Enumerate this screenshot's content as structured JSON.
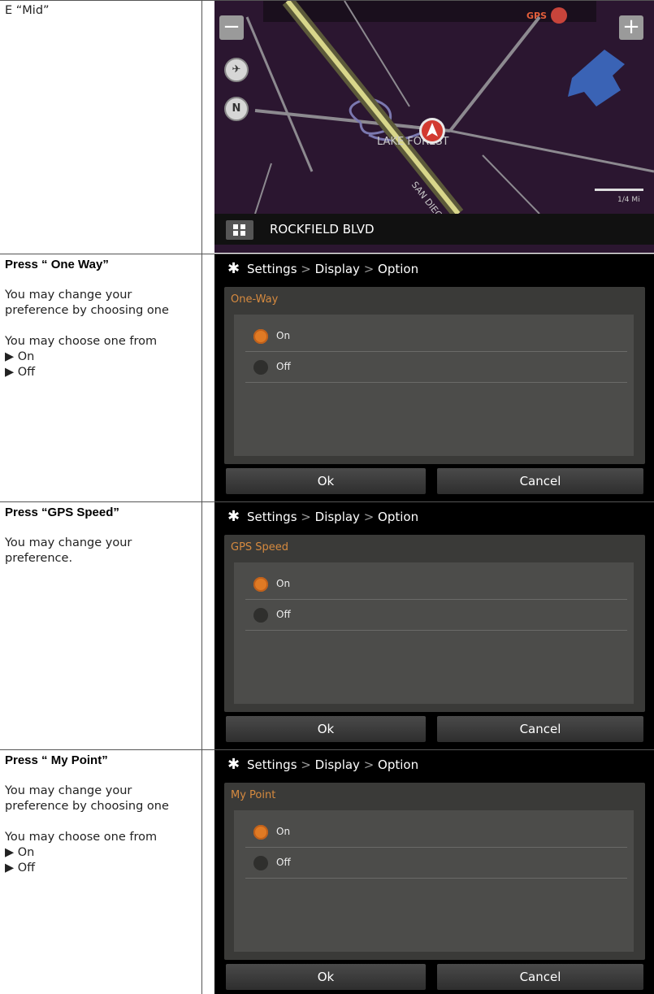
{
  "map_row": {
    "caption": "E “Mid”",
    "map": {
      "zoom_out": "−",
      "zoom_in": "+",
      "gps_label": "GPS",
      "compass_label": "N",
      "area_label": "LAKE FOREST",
      "road_label": "SAN DIEGO",
      "scale_label": "1/4 Mi",
      "street_name": "ROCKFIELD BLVD"
    }
  },
  "sections": [
    {
      "title": "Press “ One Way”",
      "desc1": "You may change your preference by choosing one",
      "desc2": "You may choose one from",
      "bullet1": "▶ On",
      "bullet2": "▶ Off",
      "screen": {
        "breadcrumb": [
          "Settings",
          "Display",
          "Option"
        ],
        "panel_title": "One-Way",
        "option_on": "On",
        "option_off": "Off",
        "selected": "On",
        "ok": "Ok",
        "cancel": "Cancel"
      }
    },
    {
      "title": "Press “GPS Speed”",
      "desc1": "You may change your preference.",
      "screen": {
        "breadcrumb": [
          "Settings",
          "Display",
          "Option"
        ],
        "panel_title": "GPS Speed",
        "option_on": "On",
        "option_off": "Off",
        "selected": "On",
        "ok": "Ok",
        "cancel": "Cancel"
      }
    },
    {
      "title": "Press “ My Point”",
      "desc1": "You may change your preference by choosing one",
      "desc2": "You may choose one from",
      "bullet1": "▶ On",
      "bullet2": "▶ Off",
      "screen": {
        "breadcrumb": [
          "Settings",
          "Display",
          "Option"
        ],
        "panel_title": "My Point",
        "option_on": "On",
        "option_off": "Off",
        "selected": "On",
        "ok": "Ok",
        "cancel": "Cancel"
      }
    }
  ],
  "colors": {
    "accent_orange": "#e07a24",
    "panel_title": "#d68a3f",
    "map_bg": "#2b1630",
    "gps_red": "#c8443b"
  }
}
